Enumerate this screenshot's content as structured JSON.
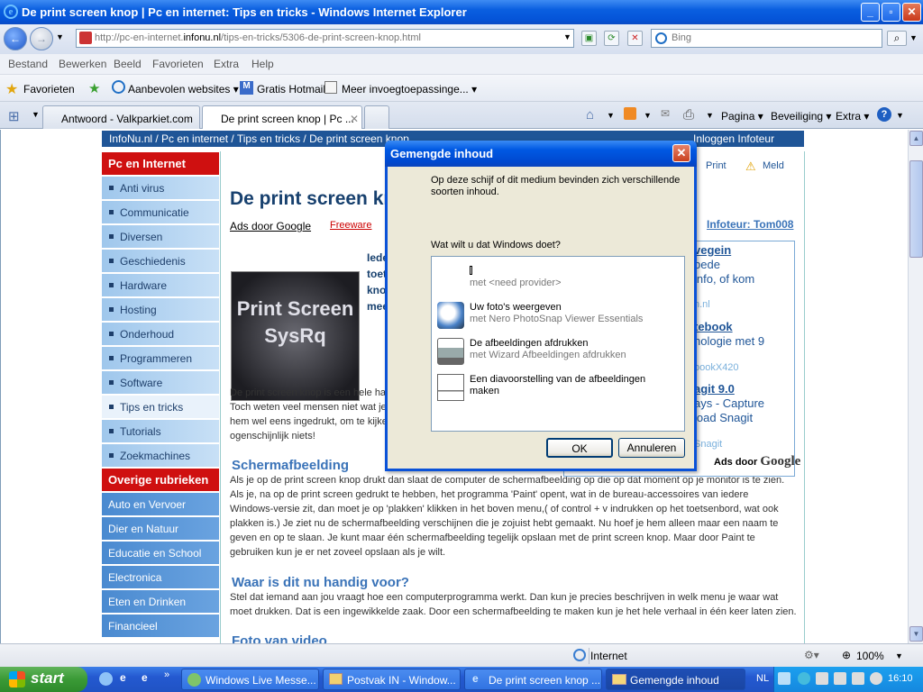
{
  "window": {
    "title": "De print screen knop | Pc en internet: Tips en tricks - Windows Internet Explorer",
    "minimize": "_",
    "maximize": "▫",
    "close": "✕"
  },
  "address": {
    "url_pre": "http://pc-en-internet.",
    "url_domain": "infonu.nl",
    "url_post": "/tips-en-tricks/5306-de-print-screen-knop.html",
    "search_placeholder": "Bing"
  },
  "menu": [
    "Bestand",
    "Bewerken",
    "Beeld",
    "Favorieten",
    "Extra",
    "Help"
  ],
  "favorites": {
    "label": "Favorieten",
    "items": [
      "Aanbevolen websites ▾",
      "Gratis Hotmail",
      "Meer invoegtoepassinge... ▾"
    ]
  },
  "tabs": [
    {
      "label": "Antwoord - Valkparkiet.com",
      "active": false
    },
    {
      "label": "De print screen knop | Pc ...",
      "active": true
    }
  ],
  "commands": [
    "Pagina ▾",
    "Beveiliging ▾",
    "Extra ▾"
  ],
  "breadcrumb": {
    "path": "InfoNu.nl  /  Pc en internet  /  Tips en tricks  /  De print screen knop",
    "login": "Inloggen Infoteur"
  },
  "sidebar": {
    "header1": "Pc en Internet",
    "items1": [
      "Anti virus",
      "Communicatie",
      "Diversen",
      "Geschiedenis",
      "Hardware",
      "Hosting",
      "Onderhoud",
      "Programmeren",
      "Software",
      "Tips en tricks",
      "Tutorials",
      "Zoekmachines"
    ],
    "selected": "Tips en tricks",
    "header2": "Overige rubrieken",
    "items2": [
      "Auto en Vervoer",
      "Dier en Natuur",
      "Educatie en School",
      "Electronica",
      "Eten en Drinken",
      "Financieel"
    ]
  },
  "article": {
    "title": "De print screen knop",
    "ads_label": "Ads door Google",
    "ads_link": "Freeware",
    "print": "Print",
    "meld": "Meld",
    "author": "Infoteur: Tom008",
    "image_text": "Print Screen SysRq",
    "intro_bold": [
      "Iede",
      "toet",
      "kno",
      "mee"
    ],
    "intro": "De print screen knop is een hele han",
    "intro2": "Toch weten veel mensen niet wat je",
    "intro3": "hem wel eens ingedrukt, om te kijker",
    "intro4": "ogenschijnlijk niets!",
    "h2a": "Schermafbeelding",
    "p1": "Als je op de print screen knop drukt dan slaat de computer de schermafbeelding op die op dat moment op je monitor is te zien. Als je, na op de print screen gedrukt te hebben, het programma 'Paint' opent, wat in de bureau-accessoires van iedere Windows-versie zit, dan moet je op 'plakken' klikken in het boven menu,( of control + v indrukken op het toetsenbord, wat ook plakken is.) Je ziet nu de schermafbeelding verschijnen die je zojuist hebt gemaakt. Nu hoef je hem alleen maar een naam te geven en op te slaan. Je kunt maar één schermafbeelding tegelijk opslaan met de print screen knop. Maar door Paint te gebruiken kun je er net zoveel opslaan als je wilt.",
    "h2b": "Waar is dit nu handig voor?",
    "p2": "Stel dat iemand aan jou vraagt hoe een computerprogramma werkt. Dan kun je precies beschrijven in welk menu je waar wat moet drukken. Dat is een ingewikkelde zaak. Door een schermafbeelding te maken kun je het hele verhaal in één keer laten zien.",
    "h2c": "Foto van video"
  },
  "rightbox": {
    "l1": "vegein",
    "l2": "bede",
    "l3": "info, of kom",
    "l4": "n.nl",
    "l5": "tebook",
    "l6": "nologie met 9",
    "l7": "bookX420",
    "l8": "agit 9.0",
    "l9": "ays - Capture",
    "l10": "load Snagit",
    "l11": "Snagit",
    "ads": "Ads door",
    "google": "Google"
  },
  "dialog": {
    "title": "Gemengde inhoud",
    "msg": "Op deze schijf of dit medium bevinden zich verschillende soorten inhoud.",
    "question": "Wat wilt u dat Windows doet?",
    "options": [
      {
        "l1": "",
        "l2": "met <need provider>"
      },
      {
        "l1": "Uw foto's weergeven",
        "l2": "met Nero PhotoSnap Viewer Essentials"
      },
      {
        "l1": "De afbeeldingen afdrukken",
        "l2": "met Wizard Afbeeldingen afdrukken"
      },
      {
        "l1": "Een diavoorstelling van de afbeeldingen",
        "l2": "maken"
      }
    ],
    "ok": "OK",
    "cancel": "Annuleren"
  },
  "status": {
    "zone": "Internet",
    "zoom": "100%"
  },
  "taskbar": {
    "start": "start",
    "tasks": [
      "Windows Live Messe...",
      "Postvak IN - Window...",
      "De print screen knop ...",
      "Gemengde inhoud"
    ],
    "lang": "NL",
    "clock": "16:10"
  }
}
